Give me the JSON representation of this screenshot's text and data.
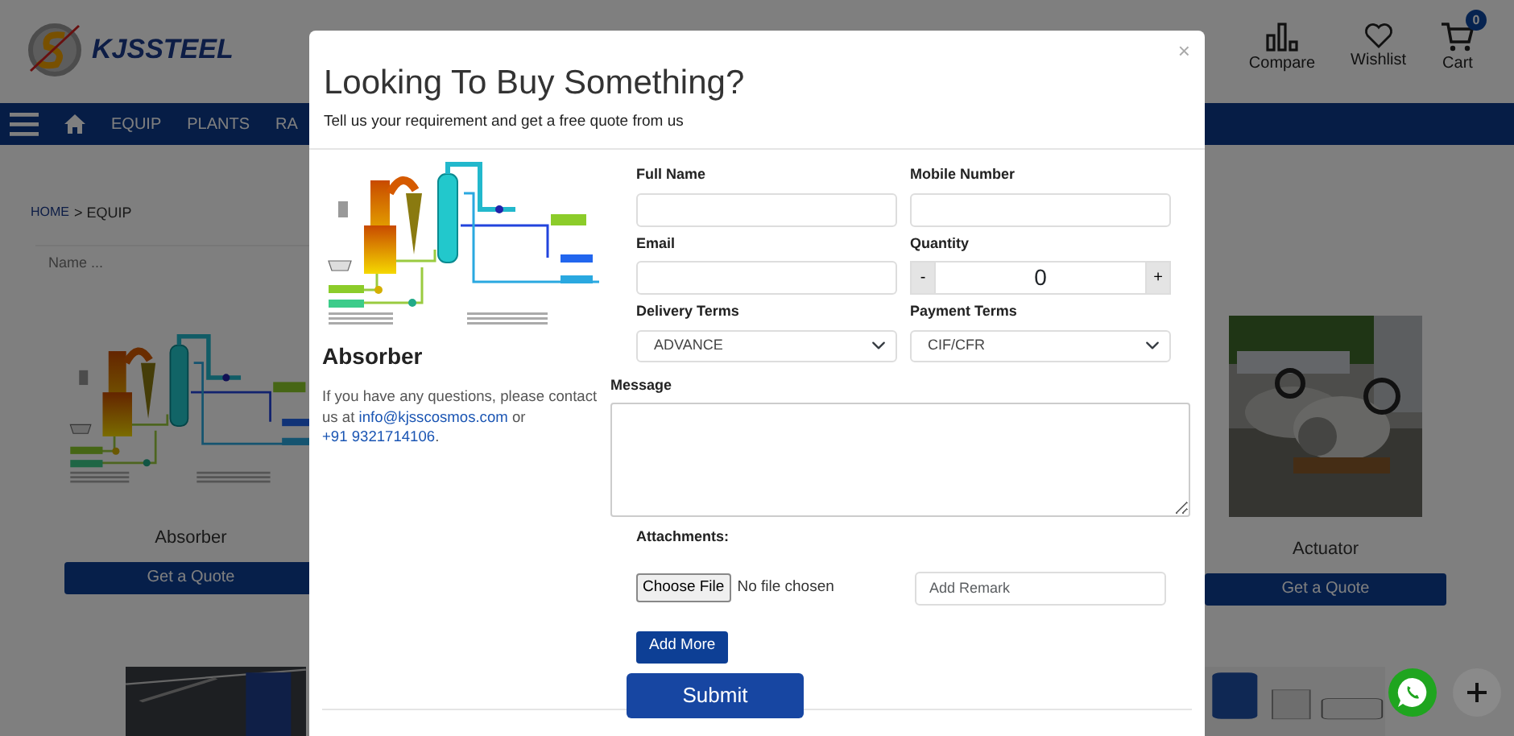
{
  "header": {
    "logo_text": "KJSSTEEL",
    "actions": [
      {
        "kind": "compare",
        "label": "Compare"
      },
      {
        "kind": "wishlist",
        "label": "Wishlist"
      },
      {
        "kind": "cart",
        "label": "Cart",
        "badge": "0"
      }
    ]
  },
  "nav": {
    "items": [
      "EQUIP",
      "PLANTS",
      "RA"
    ]
  },
  "breadcrumb": {
    "home": "HOME",
    "rest": "> EQUIP"
  },
  "search": {
    "placeholder": "Name ..."
  },
  "products": [
    {
      "name": "Absorber",
      "kind": "diagram",
      "button": "Get a Quote"
    },
    {
      "name": "Actuator",
      "kind": "picture",
      "button": "Get a Quote"
    }
  ],
  "modal": {
    "close": "×",
    "title": "Looking To Buy Something?",
    "subtitle": "Tell us your requirement and get a free quote from us",
    "product": {
      "name": "Absorber",
      "text_before": "If you have any questions, please contact us at",
      "email": "info@kjsscosmos.com",
      "text_middle": "or",
      "phone": "+91 9321714106",
      "text_after": "."
    },
    "fields": [
      {
        "kind": "text",
        "label": "Full Name"
      },
      {
        "kind": "text",
        "label": "Mobile Number"
      },
      {
        "kind": "text",
        "label": "Email"
      },
      {
        "kind": "quantity",
        "label": "Quantity",
        "value": "0",
        "minus": "-",
        "plus": "+"
      },
      {
        "kind": "select",
        "label": "Delivery Terms",
        "value": "ADVANCE"
      },
      {
        "kind": "select",
        "label": "Payment Terms",
        "value": "CIF/CFR"
      },
      {
        "kind": "textarea",
        "label": "Message"
      }
    ],
    "attachments": {
      "label": "Attachments:",
      "file_button": "Choose File",
      "file_status": "No file chosen",
      "remark_placeholder": "Add Remark",
      "add_more": "Add More"
    },
    "submit": "Submit"
  }
}
